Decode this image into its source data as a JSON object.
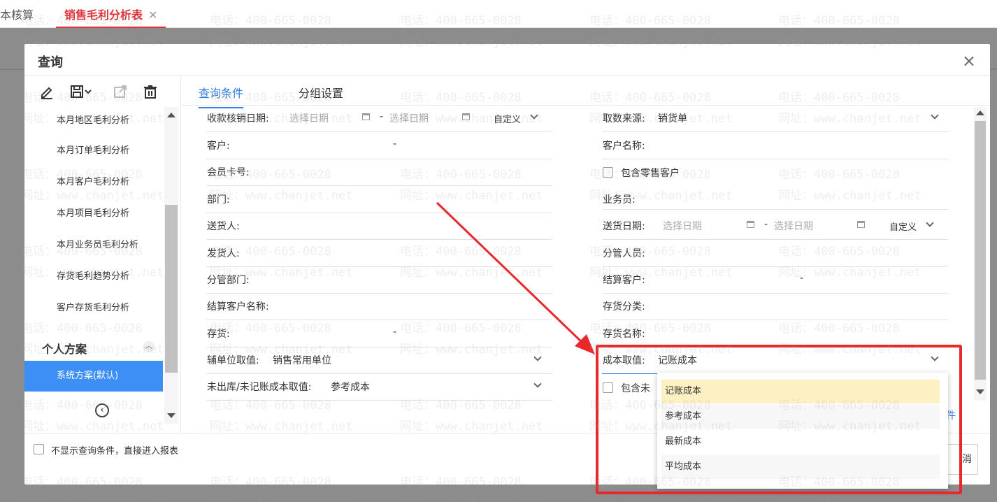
{
  "app_tabs": [
    {
      "label": "本核算"
    },
    {
      "label": "销售毛利分析表"
    }
  ],
  "dialog": {
    "title": "查询",
    "close_icon": "×"
  },
  "left_pane": {
    "schemes": [
      {
        "label": "本月地区毛利分析"
      },
      {
        "label": "本月订单毛利分析"
      },
      {
        "label": "本月客户毛利分析"
      },
      {
        "label": "本月项目毛利分析"
      },
      {
        "label": "本月业务员毛利分析"
      },
      {
        "label": "存货毛利趋势分析"
      },
      {
        "label": "客户存货毛利分析"
      }
    ],
    "section_title": "个人方案",
    "default_scheme": "系统方案(默认)"
  },
  "tabs": [
    {
      "label": "查询条件"
    },
    {
      "label": "分组设置"
    }
  ],
  "left_form": {
    "receipt_date_label": "收款核销日期:",
    "date_placeholder": "选择日期",
    "date_dash": "-",
    "custom_label": "自定义",
    "customer_label": "客户:",
    "customer_dash": "-",
    "member_card_label": "会员卡号:",
    "department_label": "部门:",
    "deliverer_label": "送货人:",
    "shipper_label": "发货人:",
    "managing_dept_label": "分管部门:",
    "settle_customer_name_label": "结算客户名称:",
    "inventory_label": "存货:",
    "inventory_dash": "-",
    "aux_unit_label": "辅单位取值:",
    "aux_unit_value": "销售常用单位",
    "unposted_cost_label": "未出库/未记账成本取值:",
    "unposted_cost_value": "参考成本"
  },
  "right_form": {
    "source_label": "取数来源:",
    "source_value": "销货单",
    "customer_name_label": "客户名称:",
    "include_retail_label": "包含零售客户",
    "salesperson_label": "业务员:",
    "delivery_date_label": "送货日期:",
    "date_placeholder": "选择日期",
    "date_dash": "-",
    "custom_label": "自定义",
    "manager_label": "分管人员:",
    "settle_customer_label": "结算客户:",
    "settle_customer_dash": "-",
    "inventory_class_label": "存货分类:",
    "inventory_name_label": "存货名称:",
    "cost_label": "成本取值:",
    "cost_value": "记账成本",
    "include_partial_label": "包含未"
  },
  "cost_dropdown": {
    "options": [
      {
        "label": "记账成本"
      },
      {
        "label": "参考成本"
      },
      {
        "label": "最新成本"
      },
      {
        "label": "平均成本"
      }
    ]
  },
  "footer": {
    "skip_label": "不显示查询条件，直接进入报表",
    "partial_link": "件",
    "partial_button": "消"
  },
  "watermark": {
    "phone": "电话：400-665-0028",
    "site": "网址：www.chanjet.net"
  },
  "colors": {
    "accent": "#2f7de1",
    "selected_scheme_bg": "#3d8ff5",
    "annotation_red": "#e8282b",
    "tab_red": "#e0333a",
    "dropdown_highlight": "#fdf1c4"
  }
}
